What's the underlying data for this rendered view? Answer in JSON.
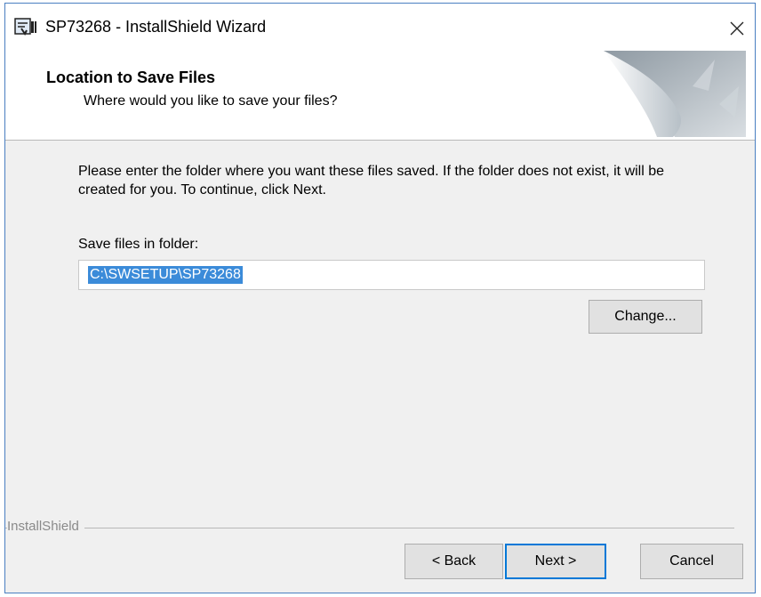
{
  "window": {
    "title": "SP73268 - InstallShield Wizard",
    "close_glyph": "✕"
  },
  "header": {
    "title": "Location to Save Files",
    "subtitle": "Where would you like to save your files?"
  },
  "body": {
    "instructions": "Please enter the folder where you want these files saved.  If the folder does not exist, it will be created for you.   To continue, click Next.",
    "folder_label": "Save files in folder:",
    "folder_value": "C:\\SWSETUP\\SP73268",
    "change_label": "Change..."
  },
  "footer": {
    "brand": "InstallShield",
    "back_label": "< Back",
    "next_label": "Next >",
    "cancel_label": "Cancel"
  },
  "colors": {
    "accent": "#0078d7",
    "selection": "#3b8bd9",
    "dialog_bg": "#f0f0f0"
  },
  "icons": {
    "app": "installer-app-icon",
    "close": "close-icon",
    "header": "page-curl-graphic"
  }
}
